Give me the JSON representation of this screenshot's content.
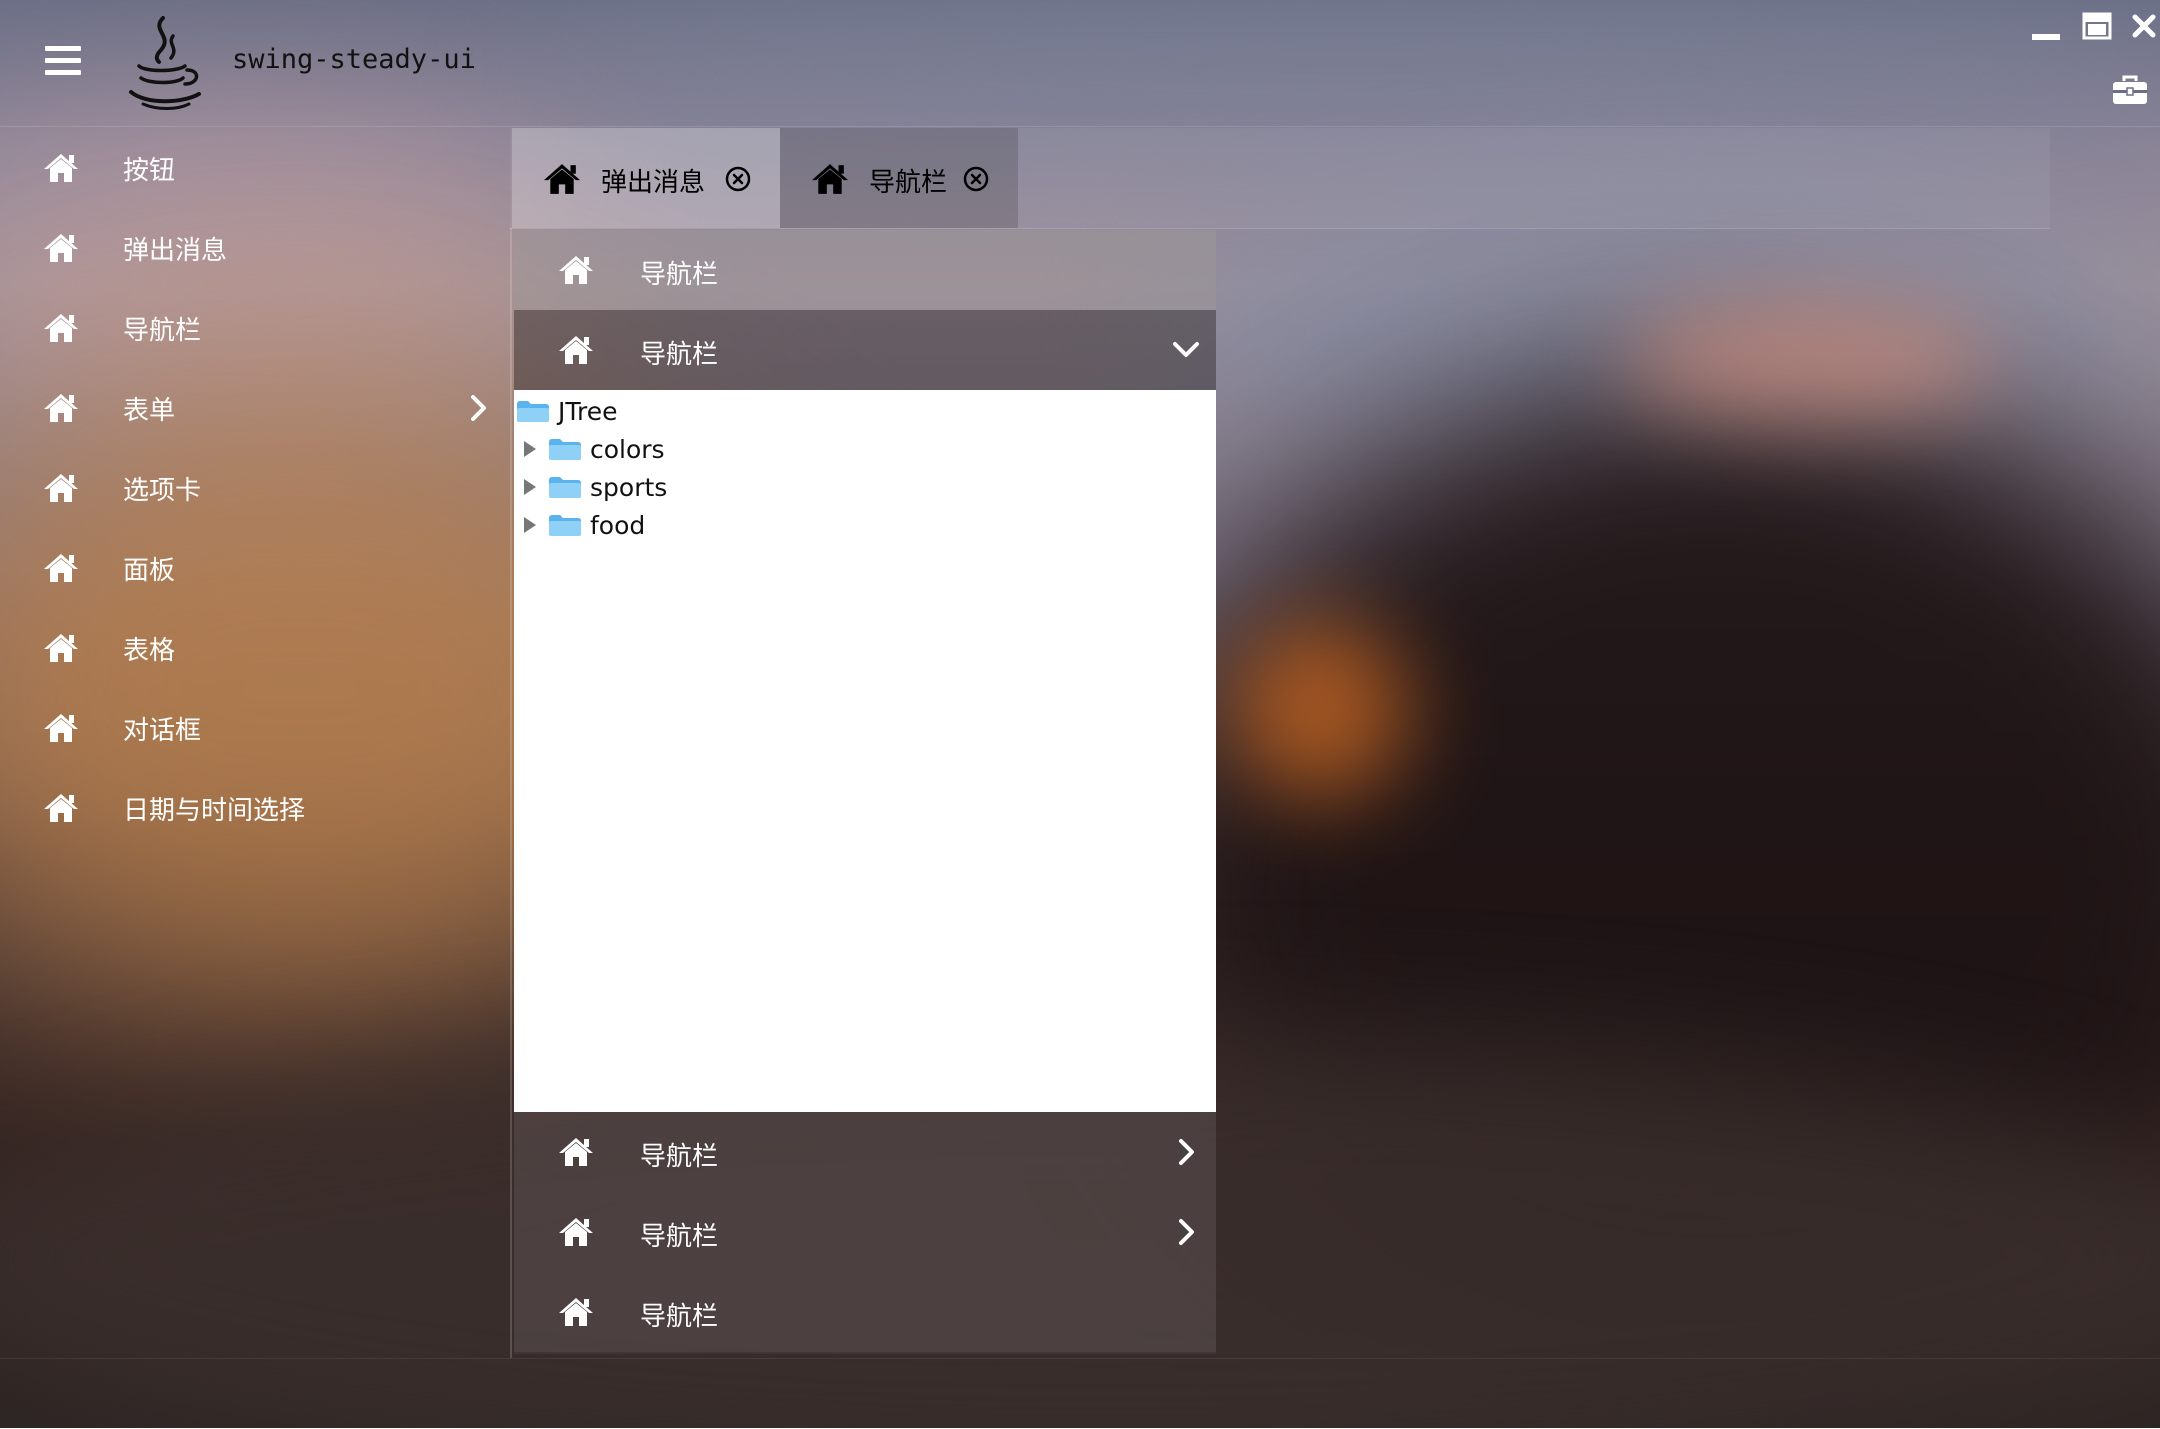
{
  "app": {
    "title": "swing-steady-ui"
  },
  "sidebar": {
    "items": [
      {
        "label": "按钮"
      },
      {
        "label": "弹出消息"
      },
      {
        "label": "导航栏"
      },
      {
        "label": "表单",
        "has_submenu": true
      },
      {
        "label": "选项卡"
      },
      {
        "label": "面板"
      },
      {
        "label": "表格"
      },
      {
        "label": "对话框"
      },
      {
        "label": "日期与时间选择"
      }
    ]
  },
  "tabs": [
    {
      "label": "弹出消息",
      "active": false
    },
    {
      "label": "导航栏",
      "active": true
    }
  ],
  "nav": {
    "items": [
      {
        "label": "导航栏",
        "state": "plain"
      },
      {
        "label": "导航栏",
        "state": "expanded"
      },
      {
        "label": "导航栏",
        "state": "collapsed"
      },
      {
        "label": "导航栏",
        "state": "collapsed"
      },
      {
        "label": "导航栏",
        "state": "plain"
      }
    ]
  },
  "tree": {
    "root": "JTree",
    "children": [
      "colors",
      "sports",
      "food"
    ]
  },
  "icons": {
    "menu": "hamburger-menu-icon",
    "logo": "java-coffee-logo",
    "minimize": "minimize-icon",
    "maximize": "maximize-icon",
    "close": "close-icon",
    "toolbox": "toolbox-icon",
    "item": "home-icon",
    "tab_close": "close-circle-icon",
    "tree_folder": "folder-icon"
  },
  "colors": {
    "tree_background": "#ffffff",
    "folder": "#5bb3ee",
    "text_dark": "#111111"
  }
}
